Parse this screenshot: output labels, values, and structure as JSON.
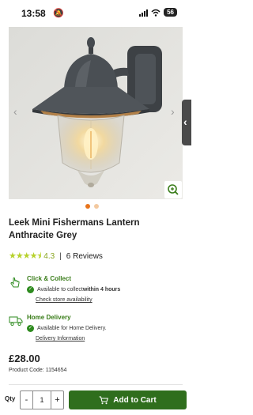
{
  "status_bar": {
    "time": "13:58",
    "battery": "56"
  },
  "product": {
    "title": "Leek Mini Fishermans Lantern Anthracite Grey",
    "rating": "4.3",
    "reviews": "6 Reviews",
    "price": "£28.00",
    "code": "Product Code: 1154654"
  },
  "gallery": {
    "slides": 2,
    "active": 0
  },
  "click_collect": {
    "title": "Click & Collect",
    "line_prefix": "Available to collect ",
    "line_strong": "within 4 hours",
    "link": "Check store availability"
  },
  "home_delivery": {
    "title": "Home Delivery",
    "line": "Available for Home Delivery.",
    "link": "Delivery Information"
  },
  "cart": {
    "qty_label": "Qty",
    "qty_value": "1",
    "minus": "-",
    "plus": "+",
    "button_label": "Add to Cart"
  },
  "colors": {
    "brand_green": "#2f6e1d",
    "star_green": "#b6d12b",
    "accent_orange": "#e8741c"
  },
  "icons": [
    "bell-slash-icon",
    "signal-icon",
    "wifi-icon",
    "battery-icon",
    "zoom-icon",
    "chevron-left-icon",
    "chevron-right-icon",
    "star-icon",
    "hand-pointer-icon",
    "truck-icon",
    "check-icon",
    "cart-icon"
  ]
}
